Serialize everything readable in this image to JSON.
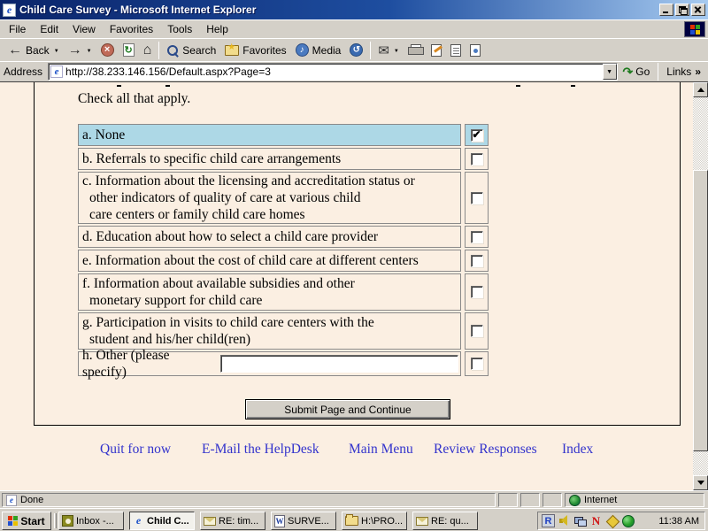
{
  "window": {
    "title": "Child Care Survey - Microsoft Internet Explorer"
  },
  "menu": {
    "items": [
      "File",
      "Edit",
      "View",
      "Favorites",
      "Tools",
      "Help"
    ]
  },
  "toolbar": {
    "back_label": "Back",
    "search_label": "Search",
    "favorites_label": "Favorites",
    "media_label": "Media"
  },
  "addressbar": {
    "label": "Address",
    "url": "http://38.233.146.156/Default.aspx?Page=3",
    "go_label": "Go",
    "links_label": "Links",
    "links_chevron": "»"
  },
  "page": {
    "instruction": "Check all that apply.",
    "options": [
      {
        "key": "a",
        "lines": [
          "a. None"
        ],
        "checked": true,
        "highlighted": true
      },
      {
        "key": "b",
        "lines": [
          "b. Referrals to specific child care arrangements"
        ],
        "checked": false
      },
      {
        "key": "c",
        "lines": [
          "c. Information about the licensing and accreditation status or",
          "other indicators of quality of care at various child",
          "care centers or family child care homes"
        ],
        "checked": false
      },
      {
        "key": "d",
        "lines": [
          "d. Education about how to select a child care provider"
        ],
        "checked": false
      },
      {
        "key": "e",
        "lines": [
          "e. Information about the cost of child care at different centers"
        ],
        "checked": false
      },
      {
        "key": "f",
        "lines": [
          "f. Information about available subsidies and other",
          "monetary support for child care"
        ],
        "checked": false
      },
      {
        "key": "g",
        "lines": [
          "g. Participation in visits to child care centers with the",
          "student and his/her child(ren)"
        ],
        "checked": false
      },
      {
        "key": "h",
        "lines": [
          "h. Other (please specify)"
        ],
        "checked": false,
        "input_value": ""
      }
    ],
    "submit_label": "Submit Page and Continue",
    "footer_links": [
      "Quit for now",
      "E-Mail the HelpDesk",
      "Main Menu",
      "Review Responses",
      "Index"
    ]
  },
  "statusbar": {
    "status": "Done",
    "zone": "Internet"
  },
  "taskbar": {
    "start_label": "Start",
    "tasks": [
      {
        "label": "Inbox -...",
        "icon": "inbox-icon",
        "active": false
      },
      {
        "label": "Child C...",
        "icon": "ie-icon",
        "active": true
      },
      {
        "label": "RE: tim...",
        "icon": "mail-icon",
        "active": false
      },
      {
        "label": "SURVE...",
        "icon": "word-icon",
        "active": false
      },
      {
        "label": "H:\\PRO...",
        "icon": "folder-icon",
        "active": false
      },
      {
        "label": "RE: qu...",
        "icon": "mail-icon",
        "active": false
      }
    ],
    "clock": "11:38 AM"
  },
  "colors": {
    "highlight_row": "#ADD8E6",
    "page_background": "#FBEFE2",
    "link": "#3333CC",
    "titlebar_left": "#0A246A",
    "titlebar_right": "#A6CAF0"
  }
}
